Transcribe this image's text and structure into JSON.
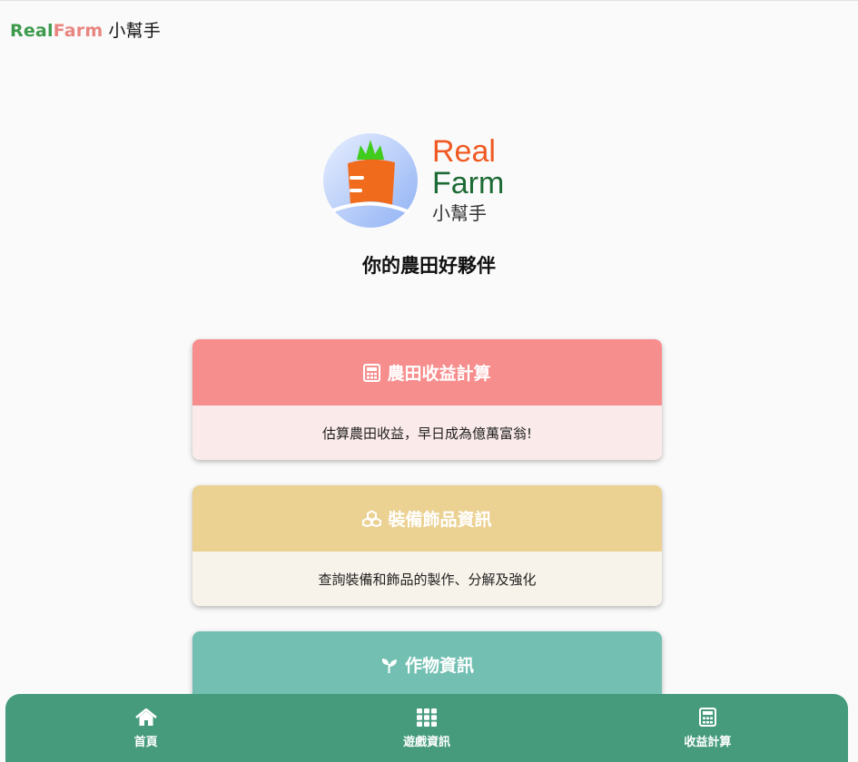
{
  "header": {
    "brand_real": "Real",
    "brand_farm": "Farm",
    "brand_sub": "小幫手"
  },
  "logo": {
    "real": "Real",
    "farm": "Farm",
    "sub": "小幫手"
  },
  "tagline": "你的農田好夥伴",
  "cards": [
    {
      "title": "農田收益計算",
      "icon": "calculator-icon",
      "desc": "估算農田收益，早日成為億萬富翁!",
      "head_color": "#f78e8e",
      "body_color": "#fbeaea"
    },
    {
      "title": "裝備飾品資訊",
      "icon": "cubes-icon",
      "desc": "查詢裝備和飾品的製作、分解及強化",
      "head_color": "#ebd192",
      "body_color": "#f8f3ea"
    },
    {
      "title": "作物資訊",
      "icon": "seedling-icon",
      "desc": "",
      "head_color": "#73c0b2",
      "body_color": ""
    }
  ],
  "nav": [
    {
      "label": "首頁",
      "icon": "home-icon"
    },
    {
      "label": "遊戲資訊",
      "icon": "grid-icon"
    },
    {
      "label": "收益計算",
      "icon": "calculator-icon"
    }
  ],
  "colors": {
    "nav_bg": "#469b7d",
    "brand_green": "#3d9a4c",
    "brand_pink": "#e98580"
  }
}
